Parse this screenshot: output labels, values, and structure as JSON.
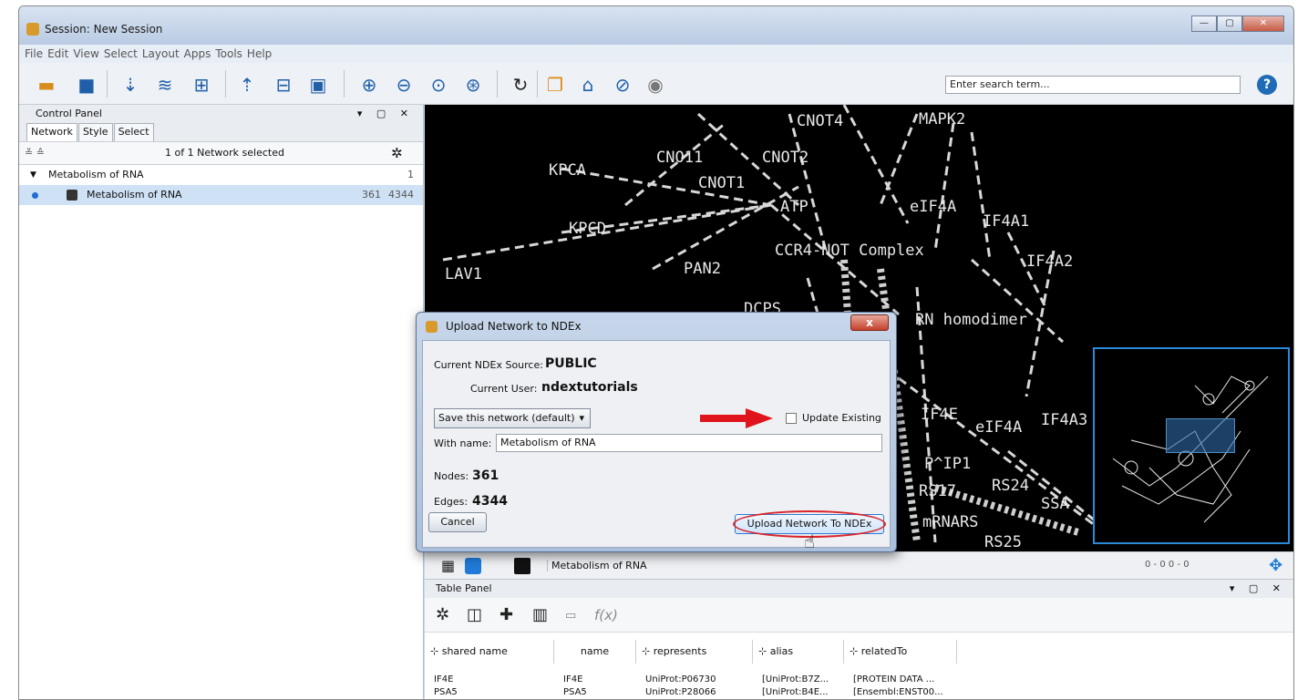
{
  "window": {
    "title": "Session: New Session"
  },
  "menu": [
    "File",
    "Edit",
    "View",
    "Select",
    "Layout",
    "Apps",
    "Tools",
    "Help"
  ],
  "toolbar": {
    "search_placeholder": "Enter search term...",
    "help": "?"
  },
  "control_panel": {
    "title": "Control Panel",
    "tabs": [
      "Network",
      "Style",
      "Select"
    ],
    "selection_status": "1 of 1 Network selected",
    "collection": {
      "name": "Metabolism of RNA",
      "count": "1"
    },
    "network": {
      "name": "Metabolism of RNA",
      "nodes": "361",
      "edges": "4344"
    }
  },
  "canvas": {
    "labels": [
      "CNOT4",
      "MAPK2",
      "KPCA",
      "CNO11",
      "CNOT2",
      "CNOT1",
      "ATP",
      "eIF4A",
      "IF4A1",
      "KPCD",
      "CCR4-NOT Complex",
      "IF4A2",
      "LAV1",
      "PAN2",
      "DCPS",
      "RN homodimer",
      "IF4E",
      "eIF4A",
      "IF4A3",
      "P^IP1",
      "RS17",
      "RS24",
      "SSA",
      "mRNARS",
      "RS25"
    ]
  },
  "network_footer": {
    "name": "Metabolism of RNA",
    "status": "0 - 0   0 - 0"
  },
  "table_panel": {
    "title": "Table Panel",
    "columns": [
      "shared name",
      "name",
      "represents",
      "alias",
      "relatedTo"
    ],
    "rows": [
      [
        "IF4E",
        "IF4E",
        "UniProt:P06730",
        "[UniProt:B7Z...",
        "[PROTEIN DATA ..."
      ],
      [
        "PSA5",
        "PSA5",
        "UniProt:P28066",
        "[UniProt:B4E...",
        "[Ensembl:ENST00..."
      ]
    ]
  },
  "dialog": {
    "title": "Upload Network to NDEx",
    "source_label": "Current NDEx Source:",
    "source_value": "PUBLIC",
    "user_label": "Current User:",
    "user_value": "ndextutorials",
    "save_mode": "Save this network (default)",
    "update_existing": "Update Existing",
    "name_label": "With name:",
    "name_value": "Metabolism of RNA",
    "nodes_label": "Nodes:",
    "nodes_value": "361",
    "edges_label": "Edges:",
    "edges_value": "4344",
    "cancel": "Cancel",
    "upload": "Upload Network To NDEx",
    "close": "x"
  }
}
